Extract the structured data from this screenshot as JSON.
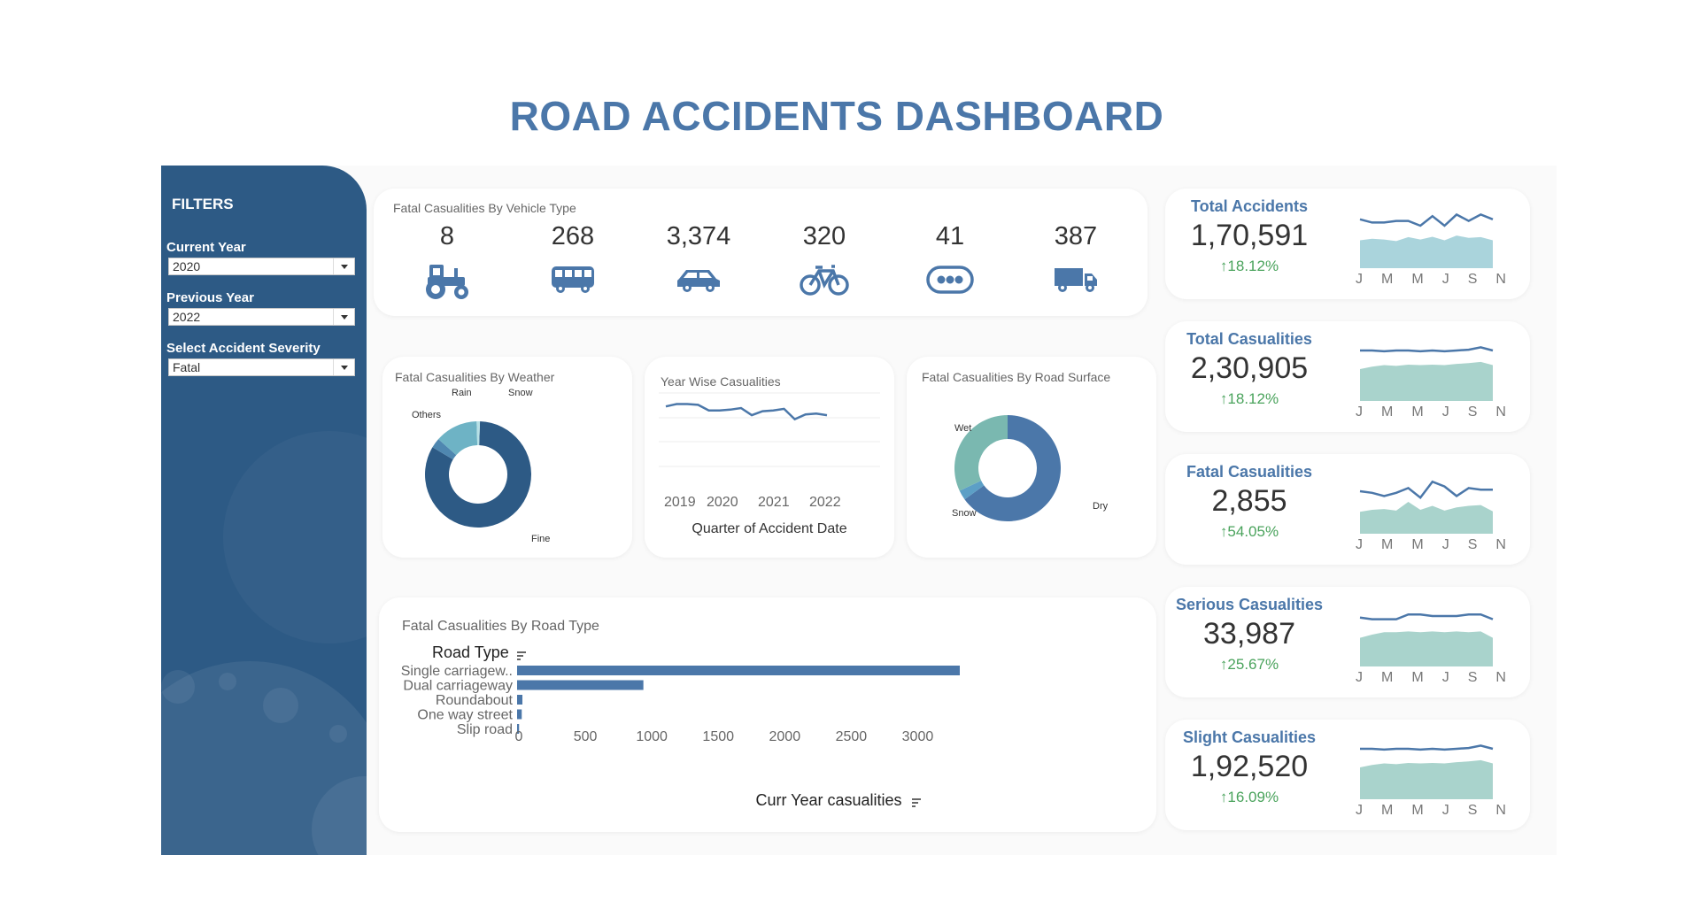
{
  "title": "ROAD ACCIDENTS DASHBOARD",
  "filters": {
    "heading": "FILTERS",
    "current_year_label": "Current Year",
    "current_year_value": "2020",
    "previous_year_label": "Previous Year",
    "previous_year_value": "2022",
    "severity_label": "Select Accident Severity",
    "severity_value": "Fatal"
  },
  "vehicle": {
    "title": "Fatal Casualities By Vehicle Type",
    "items": [
      {
        "value": "8",
        "icon": "tractor-icon"
      },
      {
        "value": "268",
        "icon": "bus-icon"
      },
      {
        "value": "3,374",
        "icon": "car-icon"
      },
      {
        "value": "320",
        "icon": "bicycle-icon"
      },
      {
        "value": "41",
        "icon": "other-vehicle-icon"
      },
      {
        "value": "387",
        "icon": "truck-icon"
      }
    ],
    "icon_color": "#4b77a9"
  },
  "weather": {
    "title": "Fatal Casualities By Weather",
    "labels": [
      "Rain",
      "Snow",
      "Others",
      "Fine"
    ]
  },
  "yearwise": {
    "title": "Year Wise Casualities",
    "ticks": [
      "2019",
      "2020",
      "2021",
      "2022"
    ],
    "xlabel": "Quarter of Accident Date"
  },
  "surface": {
    "title": "Fatal Casualities By Road Surface",
    "labels": [
      "Wet",
      "Snow",
      "Dry"
    ]
  },
  "roadtype": {
    "title": "Fatal Casualities By Road Type",
    "axis_header": "Road Type",
    "xlabel": "Curr Year casualities"
  },
  "kpis": [
    {
      "title": "Total Accidents",
      "value": "1,70,591",
      "change": "↑18.12%"
    },
    {
      "title": "Total Casualities",
      "value": "2,30,905",
      "change": "↑18.12%"
    },
    {
      "title": "Fatal Casualities",
      "value": "2,855",
      "change": "↑54.05%"
    },
    {
      "title": "Serious Casualities",
      "value": "33,987",
      "change": "↑25.67%"
    },
    {
      "title": "Slight Casualities",
      "value": "1,92,520",
      "change": "↑16.09%"
    }
  ],
  "kpi_months": [
    "J",
    "M",
    "M",
    "J",
    "S",
    "N"
  ],
  "colors": {
    "accent": "#4b77a9",
    "sidebar": "#2d5a85",
    "positive": "#4aa35c",
    "spark_area_1": "#aad4dc",
    "spark_area": "#a9d3cc",
    "bar": "#4b77a9"
  },
  "chart_data": [
    {
      "type": "pie",
      "title": "Fatal Casualities By Weather",
      "categories": [
        "Fine",
        "Others",
        "Rain",
        "Snow"
      ],
      "values": [
        83,
        3,
        13,
        1
      ]
    },
    {
      "type": "line",
      "title": "Year Wise Casualities",
      "xlabel": "Quarter of Accident Date",
      "x": [
        "2019 Q1",
        "2019 Q2",
        "2019 Q3",
        "2019 Q4",
        "2020 Q1",
        "2020 Q2",
        "2020 Q3",
        "2020 Q4",
        "2021 Q1",
        "2021 Q2",
        "2021 Q3",
        "2021 Q4",
        "2022 Q1",
        "2022 Q2",
        "2022 Q3",
        "2022 Q4"
      ],
      "values": [
        82,
        85,
        85,
        84,
        77,
        77,
        78,
        80,
        71,
        76,
        77,
        79,
        66,
        72,
        73,
        71
      ],
      "ylim": [
        0,
        100
      ],
      "grid": true
    },
    {
      "type": "pie",
      "title": "Fatal Casualities By Road Surface",
      "categories": [
        "Dry",
        "Snow",
        "Wet"
      ],
      "values": [
        65,
        3,
        32
      ]
    },
    {
      "type": "bar",
      "title": "Fatal Casualities By Road Type",
      "xlabel": "Curr Year casualities",
      "ylabel": "Road Type",
      "categories": [
        "Single carriagew..",
        "Dual carriageway",
        "Roundabout",
        "One way street",
        "Slip road"
      ],
      "values": [
        3330,
        950,
        40,
        35,
        15
      ],
      "xlim": [
        0,
        3300
      ],
      "xticks": [
        0,
        500,
        1000,
        1500,
        2000,
        2500,
        3000
      ]
    },
    {
      "type": "area",
      "title": "Total Accidents",
      "values": [
        70,
        74,
        72,
        68,
        78,
        72,
        79,
        70,
        82,
        76,
        78,
        70
      ],
      "line": [
        88,
        84,
        84,
        86,
        86,
        80,
        92,
        80,
        94,
        86,
        94,
        88
      ]
    },
    {
      "type": "area",
      "title": "Total Casualities",
      "values": [
        80,
        86,
        90,
        88,
        91,
        90,
        91,
        90,
        93,
        95,
        98,
        90
      ],
      "line": [
        90,
        90,
        89,
        90,
        90,
        89,
        90,
        89,
        90,
        91,
        94,
        90
      ]
    },
    {
      "type": "area",
      "title": "Fatal Casualities",
      "values": [
        55,
        60,
        62,
        58,
        80,
        60,
        70,
        58,
        66,
        70,
        72,
        56
      ],
      "line": [
        80,
        78,
        74,
        78,
        84,
        72,
        92,
        86,
        74,
        84,
        82,
        82
      ]
    },
    {
      "type": "area",
      "title": "Serious Casualities",
      "values": [
        72,
        80,
        86,
        86,
        88,
        86,
        88,
        86,
        88,
        86,
        88,
        72
      ],
      "line": [
        88,
        86,
        86,
        86,
        92,
        92,
        90,
        90,
        90,
        92,
        92,
        86
      ]
    },
    {
      "type": "area",
      "title": "Slight Casualities",
      "values": [
        80,
        86,
        90,
        88,
        91,
        90,
        91,
        90,
        93,
        95,
        98,
        90
      ],
      "line": [
        90,
        90,
        89,
        90,
        90,
        89,
        90,
        89,
        90,
        91,
        94,
        90
      ]
    }
  ]
}
